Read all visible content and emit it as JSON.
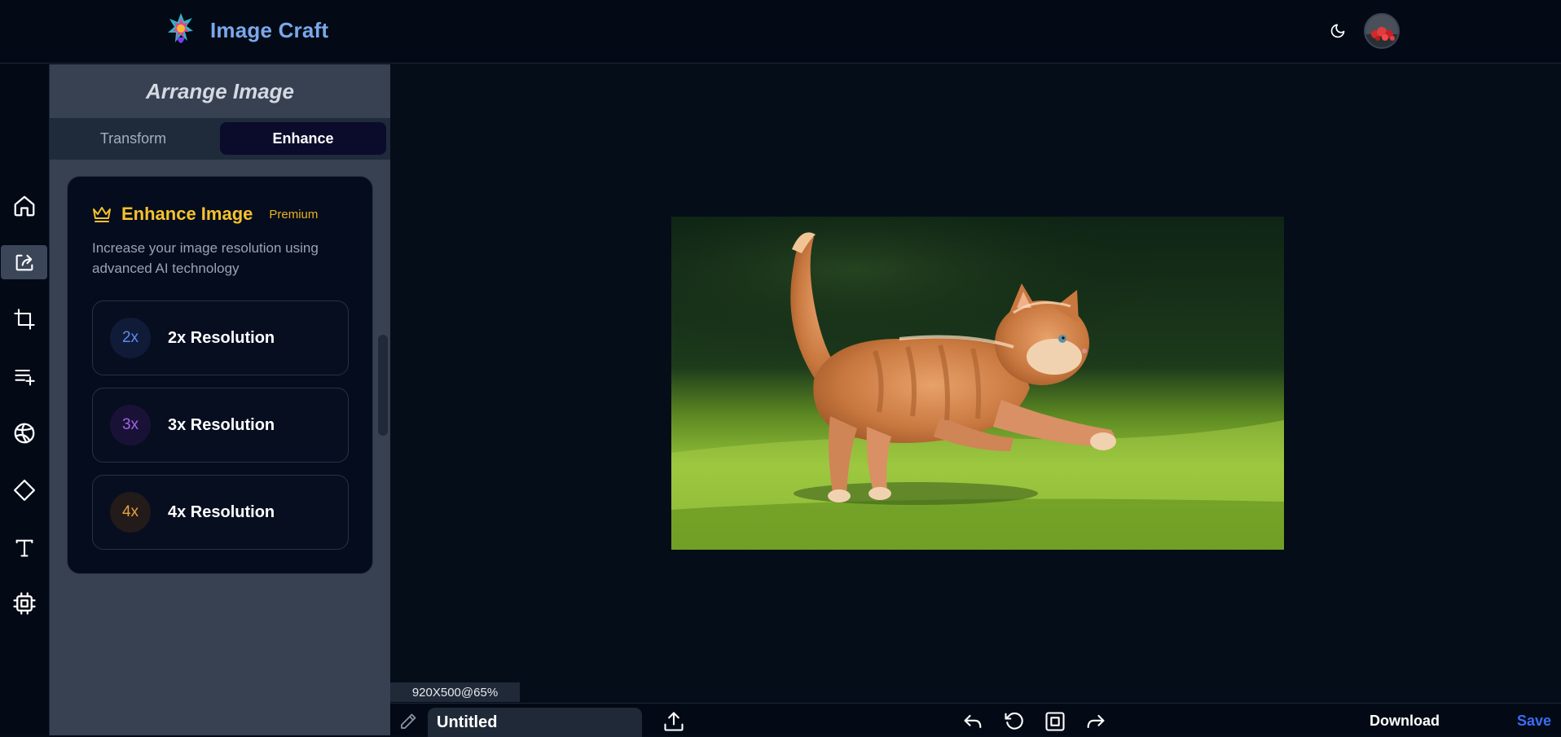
{
  "header": {
    "brand": "Image Craft",
    "logo_icon": "colorful-splash-logo",
    "theme_icon": "moon-icon",
    "avatar_icon": "user-avatar"
  },
  "rail": {
    "items": [
      {
        "name": "home",
        "icon": "home-icon",
        "active": false
      },
      {
        "name": "arrange",
        "icon": "arrange-share-icon",
        "active": true
      },
      {
        "name": "crop",
        "icon": "crop-icon",
        "active": false
      },
      {
        "name": "add-list",
        "icon": "list-add-icon",
        "active": false
      },
      {
        "name": "filters",
        "icon": "aperture-icon",
        "active": false
      },
      {
        "name": "shapes",
        "icon": "diamond-icon",
        "active": false
      },
      {
        "name": "text",
        "icon": "text-icon",
        "active": false
      },
      {
        "name": "ai",
        "icon": "chip-icon",
        "active": false
      }
    ]
  },
  "panel": {
    "title": "Arrange Image",
    "tabs": [
      {
        "label": "Transform",
        "active": false
      },
      {
        "label": "Enhance",
        "active": true
      }
    ],
    "card": {
      "icon": "crown-icon",
      "title": "Enhance Image",
      "badge": "Premium",
      "description": "Increase your image resolution using advanced AI technology",
      "options": [
        {
          "badge": "2x",
          "label": "2x Resolution",
          "color": "#5b8def",
          "bg": "#101b38"
        },
        {
          "badge": "3x",
          "label": "3x Resolution",
          "color": "#a065e8",
          "bg": "#1a1236"
        },
        {
          "badge": "4x",
          "label": "4x Resolution",
          "color": "#e9a23b",
          "bg": "#231a1a"
        }
      ]
    }
  },
  "canvas": {
    "image_subject": "orange kitten running on grass",
    "zoom_info": "920X500@65%"
  },
  "toolbar": {
    "title_value": "Untitled",
    "edit_icon": "pencil-icon",
    "upload_icon": "upload-icon",
    "undo_icon": "undo-icon",
    "reset_icon": "rotate-ccw-icon",
    "fit_icon": "fit-frame-icon",
    "redo_icon": "redo-icon",
    "download_label": "Download",
    "save_label": "Save"
  },
  "colors": {
    "accent_blue": "#7aa8ea",
    "premium_gold": "#f6c22d",
    "save_blue": "#3b6cf6",
    "panel_bg": "#374151",
    "app_bg": "#050d18"
  }
}
